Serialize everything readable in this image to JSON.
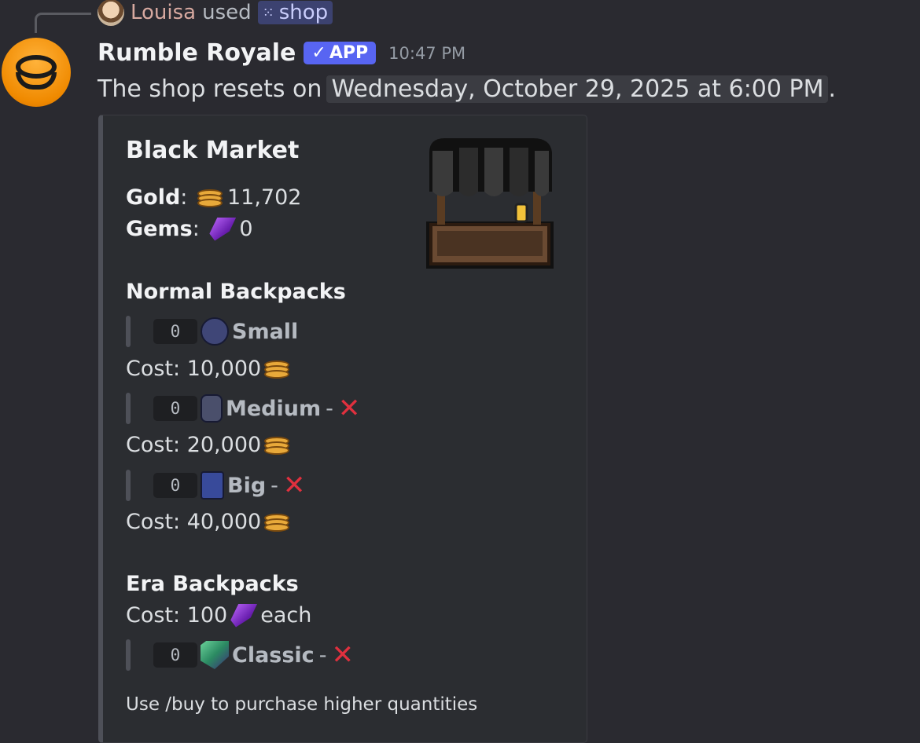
{
  "reply": {
    "user": "Louisa",
    "verb": "used",
    "command": "shop"
  },
  "message": {
    "author": "Rumble Royale",
    "badge": "APP",
    "time": "10:47 PM",
    "text_prefix": "The shop resets on",
    "reset_date": "Wednesday, October 29, 2025 at 6:00 PM",
    "text_suffix": "."
  },
  "embed": {
    "title": "Black Market",
    "gold_label": "Gold",
    "gold_value": "11,702",
    "gems_label": "Gems",
    "gems_value": "0",
    "normal_header": "Normal Backpacks",
    "normal_items": [
      {
        "qty": "0",
        "name": "Small",
        "status": "",
        "cost": "Cost: 10,000",
        "icon": "small-backpack-icon"
      },
      {
        "qty": "0",
        "name": "Medium",
        "status": "-",
        "cost": "Cost: 20,000",
        "icon": "medium-backpack-icon"
      },
      {
        "qty": "0",
        "name": "Big",
        "status": "-",
        "cost": "Cost: 40,000",
        "icon": "big-backpack-icon"
      }
    ],
    "era_header": "Era Backpacks",
    "era_cost_prefix": "Cost: 100",
    "era_cost_suffix": "each",
    "era_items": [
      {
        "qty": "0",
        "name": "Classic",
        "status": "-",
        "icon": "classic-backpack-icon"
      }
    ],
    "footer": "Use /buy to purchase higher quantities"
  },
  "icons": {
    "currency_gold": "coin-stack-icon",
    "currency_gem": "purple-gem-icon",
    "unavailable": "red-x-icon",
    "thumbnail": "market-stall-icon"
  },
  "colors": {
    "background": "#2a2a30",
    "embed_bg": "#2b2d31",
    "app_badge": "#5865f2",
    "x_red": "#e0303e",
    "command_pill": "#3c4270"
  }
}
